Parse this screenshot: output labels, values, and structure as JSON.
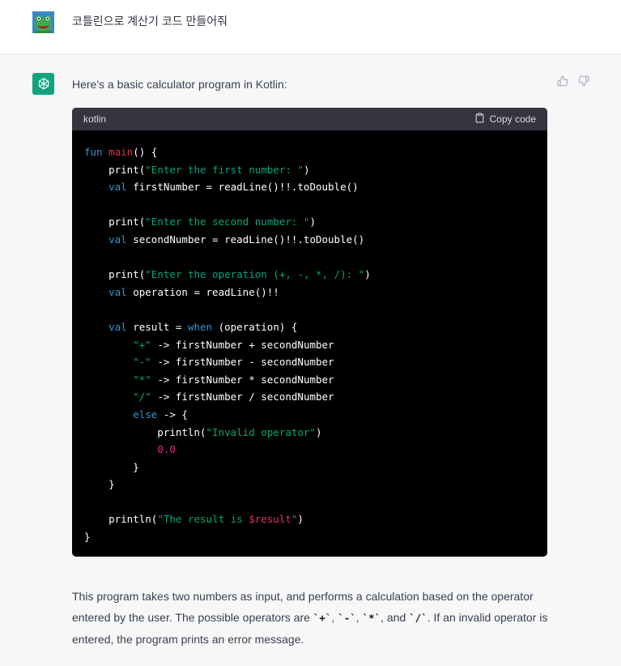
{
  "user": {
    "message": "코틀린으로 계산기 코드 만들어줘"
  },
  "assistant": {
    "intro": "Here's a basic calculator program in Kotlin:",
    "code": {
      "language": "kotlin",
      "copy_label": "Copy code",
      "lines": [
        [
          {
            "t": "fun ",
            "c": "kw"
          },
          {
            "t": "main",
            "c": "fn"
          },
          {
            "t": "() {",
            "c": ""
          }
        ],
        [
          {
            "t": "    print(",
            "c": ""
          },
          {
            "t": "\"Enter the first number: \"",
            "c": "str"
          },
          {
            "t": ")",
            "c": ""
          }
        ],
        [
          {
            "t": "    ",
            "c": ""
          },
          {
            "t": "val",
            "c": "kw"
          },
          {
            "t": " firstNumber = readLine()!!.toDouble()",
            "c": ""
          }
        ],
        [],
        [
          {
            "t": "    print(",
            "c": ""
          },
          {
            "t": "\"Enter the second number: \"",
            "c": "str"
          },
          {
            "t": ")",
            "c": ""
          }
        ],
        [
          {
            "t": "    ",
            "c": ""
          },
          {
            "t": "val",
            "c": "kw"
          },
          {
            "t": " secondNumber = readLine()!!.toDouble()",
            "c": ""
          }
        ],
        [],
        [
          {
            "t": "    print(",
            "c": ""
          },
          {
            "t": "\"Enter the operation (+, -, *, /): \"",
            "c": "str"
          },
          {
            "t": ")",
            "c": ""
          }
        ],
        [
          {
            "t": "    ",
            "c": ""
          },
          {
            "t": "val",
            "c": "kw"
          },
          {
            "t": " operation = readLine()!!",
            "c": ""
          }
        ],
        [],
        [
          {
            "t": "    ",
            "c": ""
          },
          {
            "t": "val",
            "c": "kw"
          },
          {
            "t": " result = ",
            "c": ""
          },
          {
            "t": "when",
            "c": "kw"
          },
          {
            "t": " (operation) {",
            "c": ""
          }
        ],
        [
          {
            "t": "        ",
            "c": ""
          },
          {
            "t": "\"+\"",
            "c": "str"
          },
          {
            "t": " -> firstNumber + secondNumber",
            "c": ""
          }
        ],
        [
          {
            "t": "        ",
            "c": ""
          },
          {
            "t": "\"-\"",
            "c": "str"
          },
          {
            "t": " -> firstNumber - secondNumber",
            "c": ""
          }
        ],
        [
          {
            "t": "        ",
            "c": ""
          },
          {
            "t": "\"*\"",
            "c": "str"
          },
          {
            "t": " -> firstNumber * secondNumber",
            "c": ""
          }
        ],
        [
          {
            "t": "        ",
            "c": ""
          },
          {
            "t": "\"/\"",
            "c": "str"
          },
          {
            "t": " -> firstNumber / secondNumber",
            "c": ""
          }
        ],
        [
          {
            "t": "        ",
            "c": ""
          },
          {
            "t": "else",
            "c": "kw"
          },
          {
            "t": " -> {",
            "c": ""
          }
        ],
        [
          {
            "t": "            println(",
            "c": ""
          },
          {
            "t": "\"Invalid operator\"",
            "c": "str"
          },
          {
            "t": ")",
            "c": ""
          }
        ],
        [
          {
            "t": "            ",
            "c": ""
          },
          {
            "t": "0.0",
            "c": "num"
          }
        ],
        [
          {
            "t": "        }",
            "c": ""
          }
        ],
        [
          {
            "t": "    }",
            "c": ""
          }
        ],
        [],
        [
          {
            "t": "    println(",
            "c": ""
          },
          {
            "t": "\"The result is ",
            "c": "str"
          },
          {
            "t": "$result",
            "c": "tmpl"
          },
          {
            "t": "\"",
            "c": "str"
          },
          {
            "t": ")",
            "c": ""
          }
        ],
        [
          {
            "t": "}",
            "c": ""
          }
        ]
      ]
    },
    "summary": {
      "part1": "This program takes two numbers as input, and performs a calculation based on the operator entered by the user. The possible operators are ",
      "op_plus": "`+`",
      "sep1": ", ",
      "op_minus": "`-`",
      "sep2": ", ",
      "op_times": "`*`",
      "sep3": ", and ",
      "op_div": "`/`",
      "part2": ". If an invalid operator is entered, the program prints an error message."
    }
  },
  "icons": {
    "user_avatar": "frog-avatar-icon",
    "bot_avatar": "openai-logo-icon",
    "copy": "clipboard-icon",
    "thumbs_up": "thumbs-up-icon",
    "thumbs_down": "thumbs-down-icon"
  },
  "colors": {
    "bot_avatar_bg": "#10a37f",
    "keyword": "#2e95d3",
    "function": "#f22c3d",
    "string": "#00a67d",
    "number": "#df3079"
  }
}
